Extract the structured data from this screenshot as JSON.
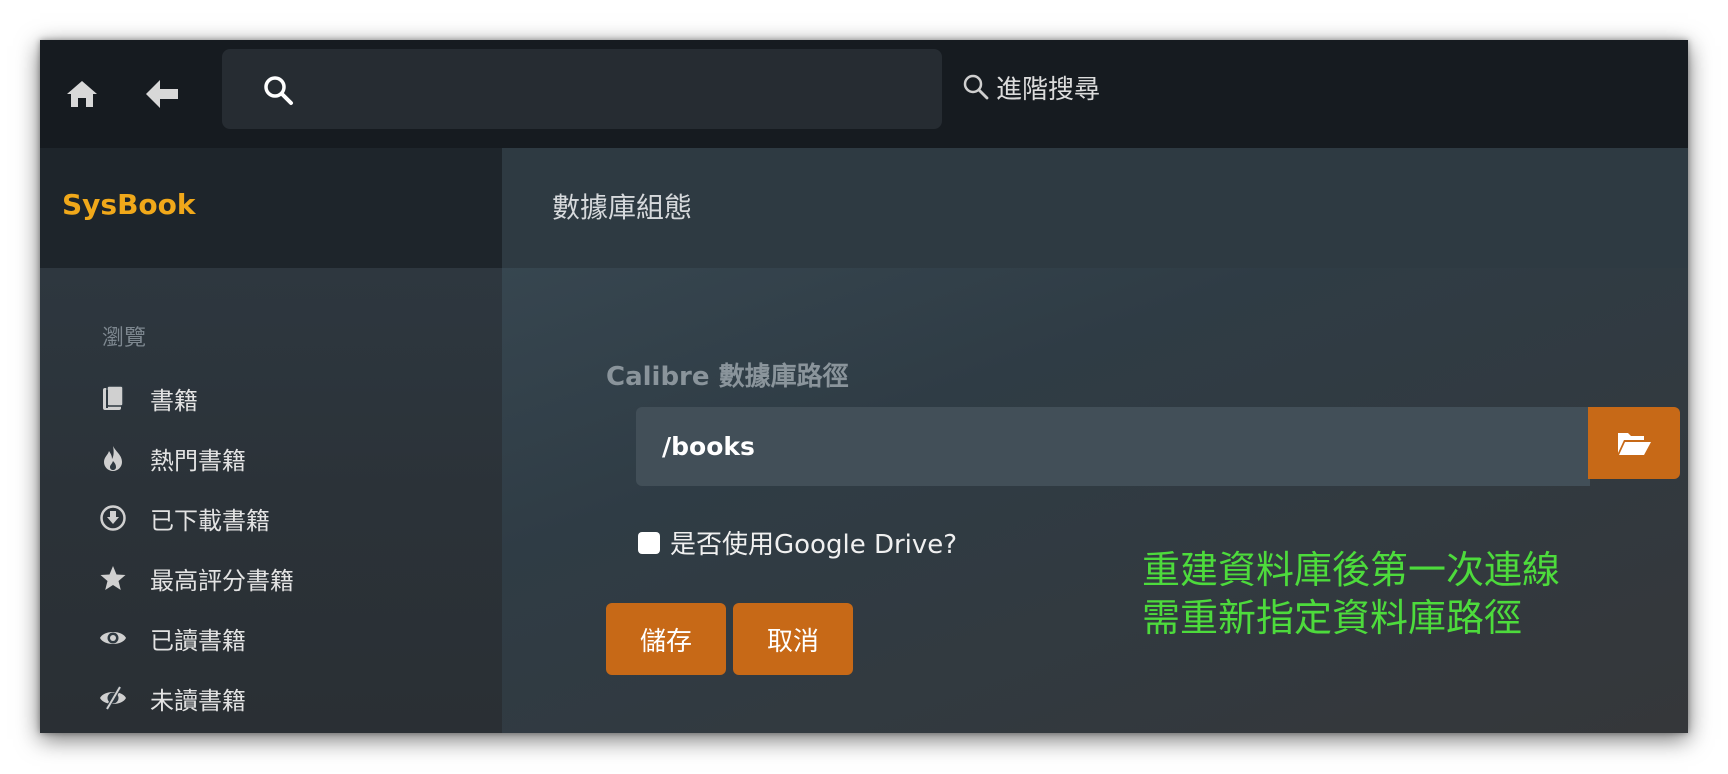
{
  "topbar": {
    "search": {
      "value": "",
      "placeholder": ""
    },
    "advanced_search_label": "進階搜尋"
  },
  "sidebar": {
    "brand": "SysBook",
    "section_label": "瀏覽",
    "items": [
      {
        "label": "書籍",
        "icon": "book-icon"
      },
      {
        "label": "熱門書籍",
        "icon": "fire-icon"
      },
      {
        "label": "已下載書籍",
        "icon": "download-icon"
      },
      {
        "label": "最高評分書籍",
        "icon": "star-icon"
      },
      {
        "label": "已讀書籍",
        "icon": "eye-icon"
      },
      {
        "label": "未讀書籍",
        "icon": "eye-slash-icon"
      }
    ]
  },
  "main": {
    "title": "數據庫組態",
    "field_label": "Calibre 數據庫路徑",
    "path_value": "/books",
    "gdrive_label": "是否使用Google Drive?",
    "gdrive_checked": false,
    "save_label": "儲存",
    "cancel_label": "取消",
    "annotation_lines": [
      "重建資料庫後第一次連線",
      "需重新指定資料庫路徑"
    ]
  },
  "colors": {
    "brand": "#f0a81a",
    "accent": "#c76917",
    "annotation": "#4ddb3c",
    "topbar_bg": "#161b20"
  }
}
